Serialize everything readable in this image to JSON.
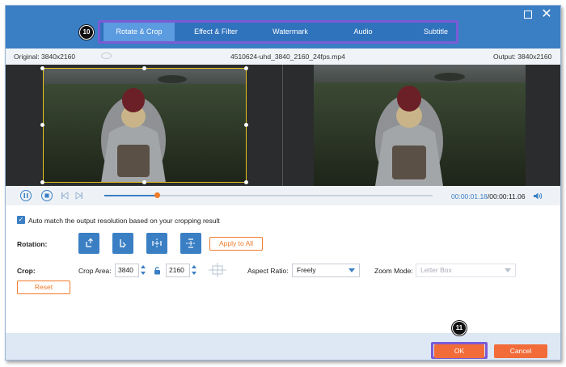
{
  "window": {
    "maximize_icon": "maximize-icon",
    "close_icon": "close-icon"
  },
  "tabs": [
    {
      "label": "Rotate & Crop",
      "active": true
    },
    {
      "label": "Effect & Filter",
      "active": false
    },
    {
      "label": "Watermark",
      "active": false
    },
    {
      "label": "Audio",
      "active": false
    },
    {
      "label": "Subtitle",
      "active": false
    }
  ],
  "annotations": {
    "tabs_step": "10",
    "ok_step": "11"
  },
  "infobar": {
    "original": "Original: 3840x2160",
    "filename": "4510624-uhd_3840_2160_24fps.mp4",
    "output": "Output: 3840x2160"
  },
  "player": {
    "current_time": "00:00:01.18",
    "total_time": "/00:00:11.06",
    "progress": 0.16
  },
  "settings": {
    "auto_match_label": "Auto match the output resolution based on your cropping result",
    "auto_match_checked": true,
    "rotation_label": "Rotation:",
    "apply_all_label": "Apply to All",
    "crop_label": "Crop:",
    "crop_area_label": "Crop Area:",
    "crop_width": "3840",
    "crop_height": "2160",
    "aspect_ratio_label": "Aspect Ratio:",
    "aspect_ratio_value": "Freely",
    "zoom_mode_label": "Zoom Mode:",
    "zoom_mode_value": "Letter Box",
    "reset_label": "Reset"
  },
  "footer": {
    "ok_label": "OK",
    "cancel_label": "Cancel"
  },
  "colors": {
    "brand_blue": "#3a7fc4",
    "accent_orange": "#f26c3a",
    "highlight_purple": "#7b5bd6",
    "crop_yellow": "#e8c51e"
  }
}
